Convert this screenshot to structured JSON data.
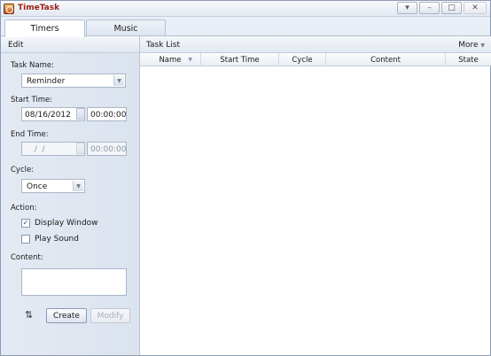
{
  "window": {
    "title": "TimeTask",
    "controls": [
      "▾",
      "–",
      "□",
      "✕"
    ]
  },
  "tabs": [
    {
      "label": "Timers",
      "active": true
    },
    {
      "label": "Music",
      "active": false
    }
  ],
  "edit_panel": {
    "header": "Edit",
    "task_name": {
      "label": "Task Name:",
      "value": "Reminder"
    },
    "start_time": {
      "label": "Start Time:",
      "date": "08/16/2012",
      "time": "00:00:00"
    },
    "end_time": {
      "label": "End Time:",
      "date": "  /  /",
      "time": "00:00:00"
    },
    "cycle": {
      "label": "Cycle:",
      "value": "Once"
    },
    "action": {
      "label": "Action:",
      "display_window": {
        "label": "Display Window",
        "checked": true
      },
      "play_sound": {
        "label": "Play Sound",
        "checked": false
      }
    },
    "content": {
      "label": "Content:",
      "value": ""
    },
    "buttons": {
      "create": "Create",
      "modify": "Modify"
    }
  },
  "task_list": {
    "header": "Task List",
    "more": "More",
    "columns": [
      "Name",
      "Start Time",
      "Cycle",
      "Content",
      "State"
    ],
    "rows": []
  },
  "colors": {
    "title_text": "#9a1f12",
    "panel_bg": "#e9eef6",
    "border": "#8e9bb0"
  }
}
